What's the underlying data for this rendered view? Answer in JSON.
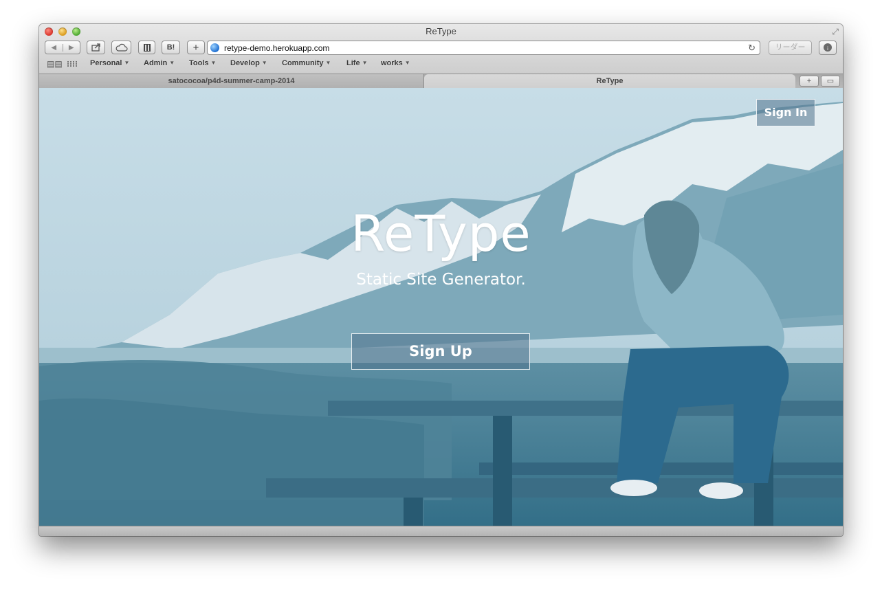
{
  "window": {
    "title": "ReType"
  },
  "toolbar": {
    "back_icon": "back-arrow-icon",
    "forward_icon": "forward-arrow-icon",
    "share_icon": "share-icon",
    "icloud_icon": "icloud-icon",
    "bookmarklet_label": "B!",
    "add_label": "+",
    "url": "retype-demo.herokuapp.com",
    "reader_label": "リーダー",
    "reload_glyph": "↻",
    "download_glyph": "↓"
  },
  "bookmarks": [
    {
      "label": "Personal"
    },
    {
      "label": "Admin"
    },
    {
      "label": "Tools"
    },
    {
      "label": "Develop"
    },
    {
      "label": "Community"
    },
    {
      "label": "Life"
    },
    {
      "label": "works"
    }
  ],
  "tabs": [
    {
      "label": "satococoa/p4d-summer-camp-2014",
      "active": false
    },
    {
      "label": "ReType",
      "active": true
    }
  ],
  "tab_actions": {
    "new_tab": "+",
    "show_all": "▭"
  },
  "page": {
    "signin_label": "Sign In",
    "hero_title": "ReType",
    "hero_subtitle": "Static Site Generator.",
    "signup_label": "Sign Up"
  },
  "colors": {
    "overlay_tint": "#2f6f8a",
    "button_fill": "#50738c"
  }
}
